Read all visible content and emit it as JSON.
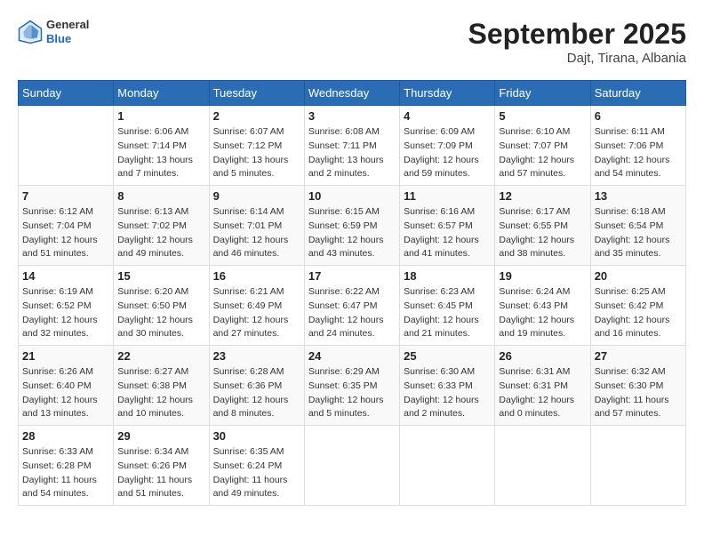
{
  "header": {
    "logo_general": "General",
    "logo_blue": "Blue",
    "month_year": "September 2025",
    "location": "Dajt, Tirana, Albania"
  },
  "weekdays": [
    "Sunday",
    "Monday",
    "Tuesday",
    "Wednesday",
    "Thursday",
    "Friday",
    "Saturday"
  ],
  "weeks": [
    [
      {
        "day": "",
        "info": ""
      },
      {
        "day": "1",
        "info": "Sunrise: 6:06 AM\nSunset: 7:14 PM\nDaylight: 13 hours\nand 7 minutes."
      },
      {
        "day": "2",
        "info": "Sunrise: 6:07 AM\nSunset: 7:12 PM\nDaylight: 13 hours\nand 5 minutes."
      },
      {
        "day": "3",
        "info": "Sunrise: 6:08 AM\nSunset: 7:11 PM\nDaylight: 13 hours\nand 2 minutes."
      },
      {
        "day": "4",
        "info": "Sunrise: 6:09 AM\nSunset: 7:09 PM\nDaylight: 12 hours\nand 59 minutes."
      },
      {
        "day": "5",
        "info": "Sunrise: 6:10 AM\nSunset: 7:07 PM\nDaylight: 12 hours\nand 57 minutes."
      },
      {
        "day": "6",
        "info": "Sunrise: 6:11 AM\nSunset: 7:06 PM\nDaylight: 12 hours\nand 54 minutes."
      }
    ],
    [
      {
        "day": "7",
        "info": "Sunrise: 6:12 AM\nSunset: 7:04 PM\nDaylight: 12 hours\nand 51 minutes."
      },
      {
        "day": "8",
        "info": "Sunrise: 6:13 AM\nSunset: 7:02 PM\nDaylight: 12 hours\nand 49 minutes."
      },
      {
        "day": "9",
        "info": "Sunrise: 6:14 AM\nSunset: 7:01 PM\nDaylight: 12 hours\nand 46 minutes."
      },
      {
        "day": "10",
        "info": "Sunrise: 6:15 AM\nSunset: 6:59 PM\nDaylight: 12 hours\nand 43 minutes."
      },
      {
        "day": "11",
        "info": "Sunrise: 6:16 AM\nSunset: 6:57 PM\nDaylight: 12 hours\nand 41 minutes."
      },
      {
        "day": "12",
        "info": "Sunrise: 6:17 AM\nSunset: 6:55 PM\nDaylight: 12 hours\nand 38 minutes."
      },
      {
        "day": "13",
        "info": "Sunrise: 6:18 AM\nSunset: 6:54 PM\nDaylight: 12 hours\nand 35 minutes."
      }
    ],
    [
      {
        "day": "14",
        "info": "Sunrise: 6:19 AM\nSunset: 6:52 PM\nDaylight: 12 hours\nand 32 minutes."
      },
      {
        "day": "15",
        "info": "Sunrise: 6:20 AM\nSunset: 6:50 PM\nDaylight: 12 hours\nand 30 minutes."
      },
      {
        "day": "16",
        "info": "Sunrise: 6:21 AM\nSunset: 6:49 PM\nDaylight: 12 hours\nand 27 minutes."
      },
      {
        "day": "17",
        "info": "Sunrise: 6:22 AM\nSunset: 6:47 PM\nDaylight: 12 hours\nand 24 minutes."
      },
      {
        "day": "18",
        "info": "Sunrise: 6:23 AM\nSunset: 6:45 PM\nDaylight: 12 hours\nand 21 minutes."
      },
      {
        "day": "19",
        "info": "Sunrise: 6:24 AM\nSunset: 6:43 PM\nDaylight: 12 hours\nand 19 minutes."
      },
      {
        "day": "20",
        "info": "Sunrise: 6:25 AM\nSunset: 6:42 PM\nDaylight: 12 hours\nand 16 minutes."
      }
    ],
    [
      {
        "day": "21",
        "info": "Sunrise: 6:26 AM\nSunset: 6:40 PM\nDaylight: 12 hours\nand 13 minutes."
      },
      {
        "day": "22",
        "info": "Sunrise: 6:27 AM\nSunset: 6:38 PM\nDaylight: 12 hours\nand 10 minutes."
      },
      {
        "day": "23",
        "info": "Sunrise: 6:28 AM\nSunset: 6:36 PM\nDaylight: 12 hours\nand 8 minutes."
      },
      {
        "day": "24",
        "info": "Sunrise: 6:29 AM\nSunset: 6:35 PM\nDaylight: 12 hours\nand 5 minutes."
      },
      {
        "day": "25",
        "info": "Sunrise: 6:30 AM\nSunset: 6:33 PM\nDaylight: 12 hours\nand 2 minutes."
      },
      {
        "day": "26",
        "info": "Sunrise: 6:31 AM\nSunset: 6:31 PM\nDaylight: 12 hours\nand 0 minutes."
      },
      {
        "day": "27",
        "info": "Sunrise: 6:32 AM\nSunset: 6:30 PM\nDaylight: 11 hours\nand 57 minutes."
      }
    ],
    [
      {
        "day": "28",
        "info": "Sunrise: 6:33 AM\nSunset: 6:28 PM\nDaylight: 11 hours\nand 54 minutes."
      },
      {
        "day": "29",
        "info": "Sunrise: 6:34 AM\nSunset: 6:26 PM\nDaylight: 11 hours\nand 51 minutes."
      },
      {
        "day": "30",
        "info": "Sunrise: 6:35 AM\nSunset: 6:24 PM\nDaylight: 11 hours\nand 49 minutes."
      },
      {
        "day": "",
        "info": ""
      },
      {
        "day": "",
        "info": ""
      },
      {
        "day": "",
        "info": ""
      },
      {
        "day": "",
        "info": ""
      }
    ]
  ]
}
